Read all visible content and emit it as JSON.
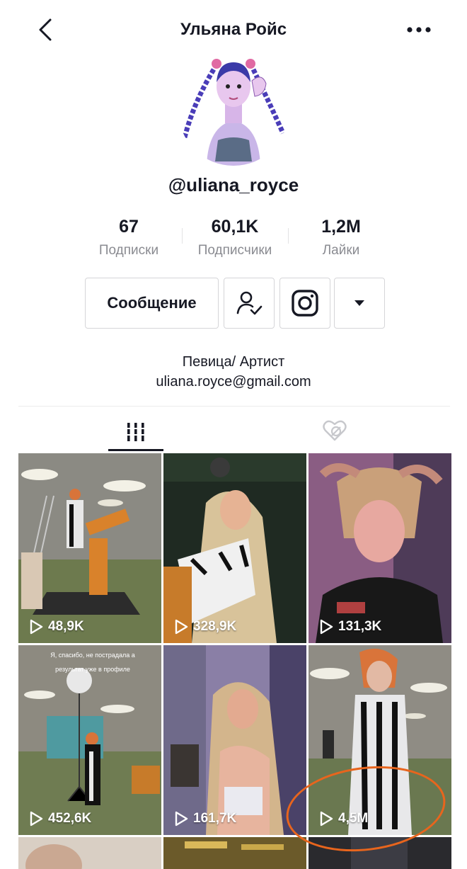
{
  "header": {
    "title": "Ульяна Ройс",
    "back_icon": "chevron-left-icon",
    "more_icon": "more-dots-icon"
  },
  "profile": {
    "handle": "@uliana_royce",
    "bio_line1": "Певица/ Артист",
    "bio_line2": "uliana.royce@gmail.com"
  },
  "stats": [
    {
      "value": "67",
      "label": "Подписки"
    },
    {
      "value": "60,1K",
      "label": "Подписчики"
    },
    {
      "value": "1,2M",
      "label": "Лайки"
    }
  ],
  "actions": {
    "message_label": "Сообщение",
    "following_icon": "user-check-icon",
    "instagram_icon": "instagram-icon",
    "dropdown_icon": "caret-down-icon"
  },
  "tabs": {
    "videos_icon": "grid-lines-icon",
    "liked_icon": "hidden-heart-icon"
  },
  "videos": [
    {
      "views": "48,9K",
      "caption": ""
    },
    {
      "views": "328,9K",
      "caption": ""
    },
    {
      "views": "131,3K",
      "caption": ""
    },
    {
      "views": "452,6K",
      "caption": "Я, спасибо, не пострадала а результат уже в профиле"
    },
    {
      "views": "161,7K",
      "caption": ""
    },
    {
      "views": "4,5M",
      "caption": ""
    }
  ],
  "colors": {
    "text": "#161823",
    "muted": "#8a8b91",
    "annotation": "#e8651d"
  }
}
